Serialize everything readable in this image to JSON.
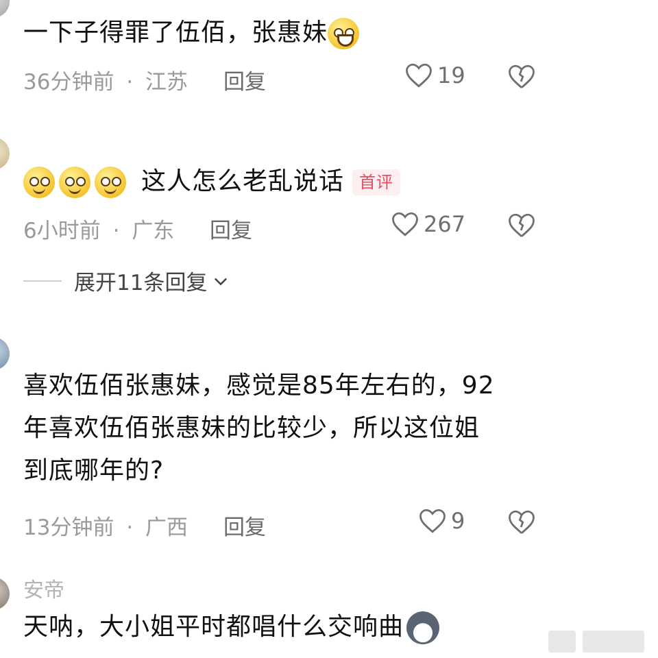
{
  "comments": [
    {
      "text": "一下子得罪了伍佰，张惠妹",
      "time": "36分钟前",
      "region": "江苏",
      "reply_label": "回复",
      "likes": "19"
    },
    {
      "text": "这人怎么老乱说话",
      "badge": "首评",
      "time": "6小时前",
      "region": "广东",
      "reply_label": "回复",
      "likes": "267",
      "expand_label": "展开11条回复"
    },
    {
      "text_lines": [
        "喜欢伍佰张惠妹，感觉是85年左右的，92",
        "年喜欢伍佰张惠妹的比较少，所以这位姐",
        "到底哪年的?"
      ],
      "time": "13分钟前",
      "region": "广西",
      "reply_label": "回复",
      "likes": "9"
    },
    {
      "username": "安帝",
      "text": "天呐，大小姐平时都唱什么交响曲"
    }
  ],
  "separator": "·",
  "colors": {
    "badge_text": "#e84c62",
    "badge_bg": "#fdeef0",
    "meta": "#9a9a9a"
  }
}
